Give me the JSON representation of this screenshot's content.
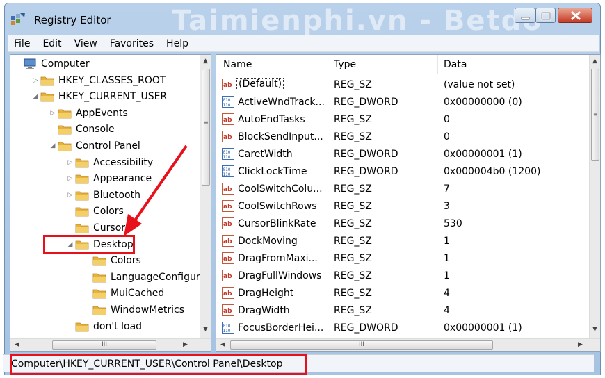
{
  "window": {
    "title": "Registry Editor",
    "watermark": "Taimienphi.vn - Betdo"
  },
  "menu": [
    "File",
    "Edit",
    "View",
    "Favorites",
    "Help"
  ],
  "tree": {
    "items": [
      {
        "label": "Computer",
        "indent": 0,
        "expander": "",
        "icon": "computer"
      },
      {
        "label": "HKEY_CLASSES_ROOT",
        "indent": 1,
        "expander": "▷",
        "icon": "folder"
      },
      {
        "label": "HKEY_CURRENT_USER",
        "indent": 1,
        "expander": "◢",
        "icon": "folder"
      },
      {
        "label": "AppEvents",
        "indent": 2,
        "expander": "▷",
        "icon": "folder"
      },
      {
        "label": "Console",
        "indent": 2,
        "expander": "",
        "icon": "folder"
      },
      {
        "label": "Control Panel",
        "indent": 2,
        "expander": "◢",
        "icon": "folder"
      },
      {
        "label": "Accessibility",
        "indent": 3,
        "expander": "▷",
        "icon": "folder"
      },
      {
        "label": "Appearance",
        "indent": 3,
        "expander": "▷",
        "icon": "folder"
      },
      {
        "label": "Bluetooth",
        "indent": 3,
        "expander": "▷",
        "icon": "folder"
      },
      {
        "label": "Colors",
        "indent": 3,
        "expander": "",
        "icon": "folder"
      },
      {
        "label": "Cursors",
        "indent": 3,
        "expander": "",
        "icon": "folder"
      },
      {
        "label": "Desktop",
        "indent": 3,
        "expander": "◢",
        "icon": "folder"
      },
      {
        "label": "Colors",
        "indent": 4,
        "expander": "",
        "icon": "folder"
      },
      {
        "label": "LanguageConfigura",
        "indent": 4,
        "expander": "",
        "icon": "folder"
      },
      {
        "label": "MuiCached",
        "indent": 4,
        "expander": "",
        "icon": "folder"
      },
      {
        "label": "WindowMetrics",
        "indent": 4,
        "expander": "",
        "icon": "folder"
      },
      {
        "label": "don't load",
        "indent": 3,
        "expander": "",
        "icon": "folder"
      }
    ],
    "hscroll_thumb": "III"
  },
  "list": {
    "columns": [
      "Name",
      "Type",
      "Data"
    ],
    "rows": [
      {
        "icon": "ab",
        "name": "(Default)",
        "type": "REG_SZ",
        "data": "(value not set)"
      },
      {
        "icon": "bin",
        "name": "ActiveWndTrack...",
        "type": "REG_DWORD",
        "data": "0x00000000 (0)"
      },
      {
        "icon": "ab",
        "name": "AutoEndTasks",
        "type": "REG_SZ",
        "data": "0"
      },
      {
        "icon": "ab",
        "name": "BlockSendInput...",
        "type": "REG_SZ",
        "data": "0"
      },
      {
        "icon": "bin",
        "name": "CaretWidth",
        "type": "REG_DWORD",
        "data": "0x00000001 (1)"
      },
      {
        "icon": "bin",
        "name": "ClickLockTime",
        "type": "REG_DWORD",
        "data": "0x000004b0 (1200)"
      },
      {
        "icon": "ab",
        "name": "CoolSwitchColu...",
        "type": "REG_SZ",
        "data": "7"
      },
      {
        "icon": "ab",
        "name": "CoolSwitchRows",
        "type": "REG_SZ",
        "data": "3"
      },
      {
        "icon": "ab",
        "name": "CursorBlinkRate",
        "type": "REG_SZ",
        "data": "530"
      },
      {
        "icon": "ab",
        "name": "DockMoving",
        "type": "REG_SZ",
        "data": "1"
      },
      {
        "icon": "ab",
        "name": "DragFromMaxi...",
        "type": "REG_SZ",
        "data": "1"
      },
      {
        "icon": "ab",
        "name": "DragFullWindows",
        "type": "REG_SZ",
        "data": "1"
      },
      {
        "icon": "ab",
        "name": "DragHeight",
        "type": "REG_SZ",
        "data": "4"
      },
      {
        "icon": "ab",
        "name": "DragWidth",
        "type": "REG_SZ",
        "data": "4"
      },
      {
        "icon": "bin",
        "name": "FocusBorderHei...",
        "type": "REG_DWORD",
        "data": "0x00000001 (1)"
      }
    ],
    "hscroll_thumb": "III"
  },
  "status": {
    "path": "Computer\\HKEY_CURRENT_USER\\Control Panel\\Desktop"
  },
  "colors": {
    "highlight": "#e8101a",
    "folder": "#e8b23a",
    "titlebar": "#b9d1ea"
  }
}
